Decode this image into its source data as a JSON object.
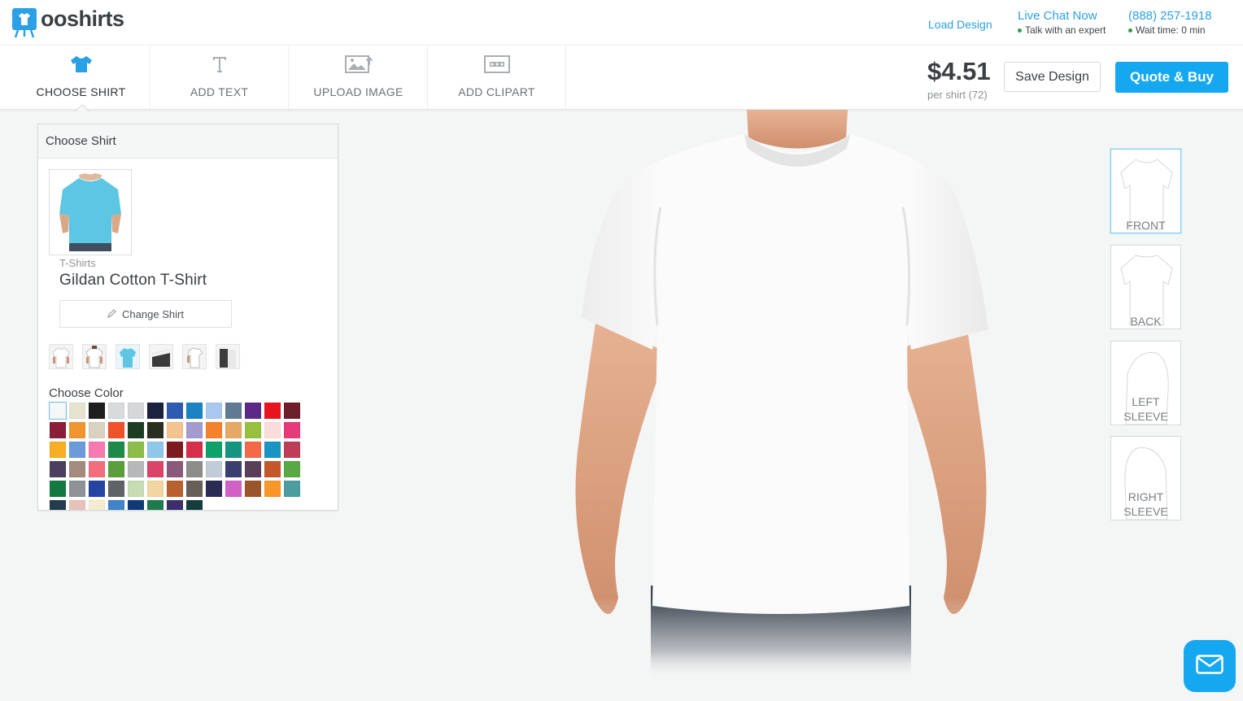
{
  "brand": {
    "name": "ooshirts"
  },
  "header": {
    "load_design": "Load Design",
    "live_chat": "Live Chat Now",
    "talk_note": "Talk with an expert",
    "phone": "(888) 257-1918",
    "wait_note": "Wait time: 0 min"
  },
  "toolbar": {
    "tabs": [
      {
        "label": "CHOOSE SHIRT",
        "icon": "tshirt-icon",
        "active": true
      },
      {
        "label": "ADD TEXT",
        "icon": "text-icon",
        "active": false
      },
      {
        "label": "UPLOAD IMAGE",
        "icon": "image-upload-icon",
        "active": false
      },
      {
        "label": "ADD CLIPART",
        "icon": "clipart-icon",
        "active": false
      }
    ],
    "price": "$4.51",
    "per_shirt": "per shirt (72)",
    "save_label": "Save Design",
    "quote_label": "Quote & Buy"
  },
  "panel": {
    "title": "Choose Shirt",
    "category": "T-Shirts",
    "product_name": "Gildan Cotton T-Shirt",
    "change_label": "Change Shirt",
    "color_title": "Choose Color",
    "style_thumbs": [
      "white-front",
      "white-back",
      "blue",
      "dark-fold",
      "white-side",
      "dark-side"
    ],
    "colors": [
      "#f6f7f8",
      "#e6e2d0",
      "#1e1e1e",
      "#d9dadb",
      "#d6d7d9",
      "#1c2140",
      "#2e5bb2",
      "#1a84c3",
      "#a9c8ef",
      "#5f7a92",
      "#5b2a86",
      "#e8141e",
      "#6e1d2b",
      "#8a1d37",
      "#f0962f",
      "#d9d2c2",
      "#ee5329",
      "#1d3d23",
      "#2a2e22",
      "#f2c48f",
      "#a39bd0",
      "#f4822a",
      "#e5a865",
      "#96c03e",
      "#fbdedc",
      "#e63a79",
      "#f8ae24",
      "#6c9bd9",
      "#f47ab0",
      "#1e8a4a",
      "#8cbd4a",
      "#8fc7ea",
      "#7c1c1f",
      "#d52f4b",
      "#0ea16a",
      "#14957f",
      "#f46a49",
      "#1a93c5",
      "#be3e5a",
      "#4b3e5f",
      "#a48b7e",
      "#f26d7d",
      "#5c9d3c",
      "#b7b8ba",
      "#d94468",
      "#8a5a7c",
      "#8c8d88",
      "#c2ccd8",
      "#3b3f6f",
      "#5a3f58",
      "#c3582b",
      "#59a846",
      "#107a41",
      "#8f9295",
      "#2645a3",
      "#5f6266",
      "#c6dcb3",
      "#f2d5a0",
      "#b8612e",
      "#666058",
      "#2a2c55",
      "#d261c6",
      "#9b552b",
      "#f7962b",
      "#4c9d9f",
      "#233d4f",
      "#e8c2b9",
      "#f4ebd0",
      "#3f83c9",
      "#0f3a78",
      "#1f7a4e",
      "#3b2f6b",
      "#143d3c"
    ]
  },
  "views": [
    {
      "label": "FRONT",
      "active": true
    },
    {
      "label": "BACK",
      "active": false
    },
    {
      "label": "LEFT SLEEVE",
      "active": false
    },
    {
      "label": "RIGHT SLEEVE",
      "active": false
    }
  ],
  "icons": {
    "mail": "envelope-icon",
    "pencil": "pencil-icon"
  }
}
